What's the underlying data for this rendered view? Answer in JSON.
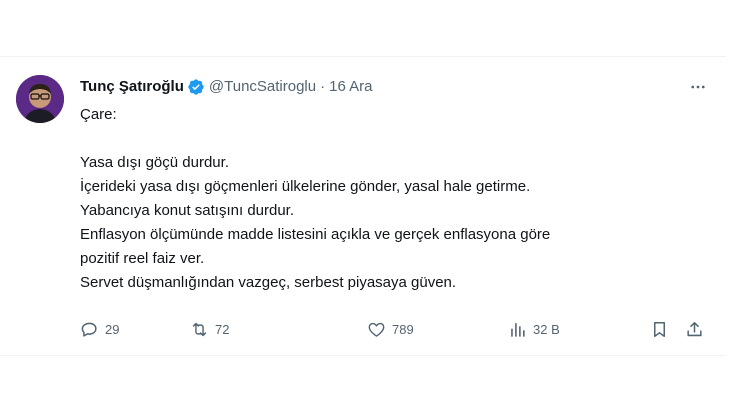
{
  "tweet": {
    "author_name": "Tunç Şatıroğlu",
    "author_handle": "@TuncSatiroglu",
    "separator": "·",
    "date": "16 Ara",
    "lines": [
      "Çare:",
      "",
      "Yasa dışı göçü durdur.",
      "İçerideki yasa dışı göçmenleri ülkelerine gönder, yasal hale getirme.",
      "Yabancıya konut satışını durdur.",
      "Enflasyon ölçümünde madde listesini açıkla ve gerçek enflasyona göre",
      "pozitif reel faiz ver.",
      "Servet düşmanlığından vazgeç, serbest piyasaya güven."
    ],
    "stats": {
      "replies": "29",
      "retweets": "72",
      "likes": "789",
      "views": "32 B"
    }
  },
  "icons": {
    "verified": "verified-badge-icon",
    "more": "more-options-icon",
    "reply": "reply-icon",
    "retweet": "retweet-icon",
    "like": "heart-icon",
    "views": "views-chart-icon",
    "bookmark": "bookmark-icon",
    "share": "share-icon"
  },
  "colors": {
    "verified_blue": "#1d9bf0",
    "text_primary": "#0f1419",
    "text_secondary": "#536471",
    "divider": "#eff3f4"
  }
}
